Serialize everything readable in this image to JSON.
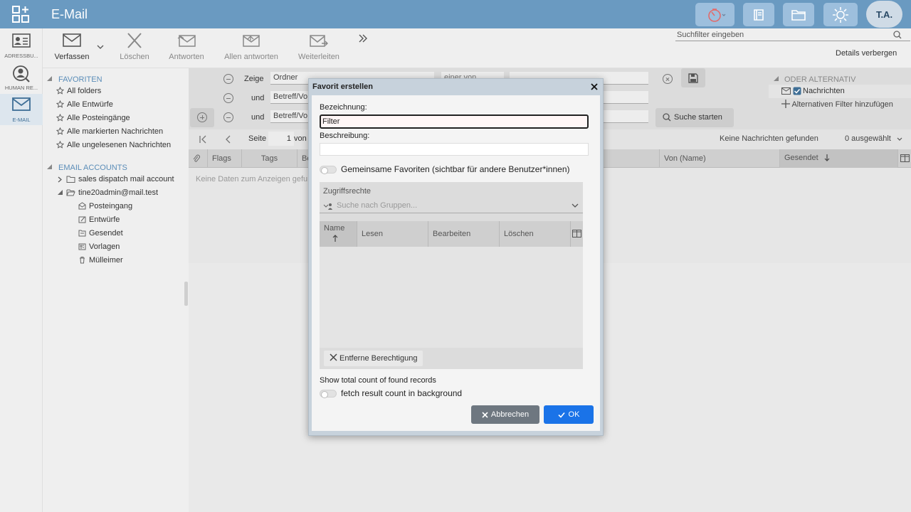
{
  "app": {
    "title": "E-Mail",
    "avatar_initials": "T.A."
  },
  "appbar": {
    "items": [
      {
        "label": "ADRESSBU..."
      },
      {
        "label": "HUMAN RE..."
      },
      {
        "label": "E-MAIL"
      }
    ]
  },
  "toolbar": {
    "compose": "Verfassen",
    "delete": "Löschen",
    "reply": "Antworten",
    "reply_all": "Allen antworten",
    "forward": "Weiterleiten",
    "search_placeholder": "Suchfilter eingeben",
    "details": "Details verbergen"
  },
  "tree": {
    "favorites_head": "FAVORITEN",
    "favorites": [
      "All folders",
      "Alle Entwürfe",
      "Alle Posteingänge",
      "Alle markierten Nachrichten",
      "Alle ungelesenen Nachrichten"
    ],
    "accounts_head": "EMAIL ACCOUNTS",
    "accounts": [
      {
        "label": "sales dispatch mail account"
      },
      {
        "label": "tine20admin@mail.test"
      }
    ],
    "folders": [
      "Posteingang",
      "Entwürfe",
      "Gesendet",
      "Vorlagen",
      "Mülleimer"
    ]
  },
  "filter": {
    "row1_word": "Zeige",
    "row1_field": "Ordner",
    "row1_operator": "einer von",
    "row2_word": "und",
    "row2_field": "Betreff/Vo",
    "row3_word": "und",
    "row3_field": "Betreff/Vo",
    "search_button": "Suche starten",
    "alt_head": "ODER ALTERNATIV",
    "alt_item": "Nachrichten",
    "alt_add": "Alternativen Filter hinzufügen"
  },
  "grid": {
    "page_label": "Seite",
    "page_number": "1",
    "page_of": "von",
    "no_messages": "Keine Nachrichten gefunden",
    "selected": "0 ausgewählt",
    "columns": [
      "Flags",
      "Tags",
      "Be",
      "Von (Name)",
      "Gesendet"
    ],
    "empty": "Keine Daten zum Anzeigen gefu"
  },
  "modal": {
    "title": "Favorit erstellen",
    "name_label": "Bezeichnung:",
    "name_value": "Filter",
    "desc_label": "Beschreibung:",
    "shared_label": "Gemeinsame Favoriten (sichtbar für andere Benutzer*innen)",
    "grants_title": "Zugriffsrechte",
    "grants_search": "Suche nach Gruppen...",
    "grants_columns": [
      "Name",
      "Lesen",
      "Bearbeiten",
      "Löschen"
    ],
    "remove_grant": "Entferne Berechtigung",
    "count_label": "Show total count of found records",
    "count_bg_label": "fetch result count in background",
    "cancel": "Abbrechen",
    "ok": "OK"
  },
  "colors": {
    "topbar": "#6a9ac1",
    "accent": "#5b8db8",
    "ok_button": "#1a73e8",
    "cancel_button": "#6e7780"
  }
}
